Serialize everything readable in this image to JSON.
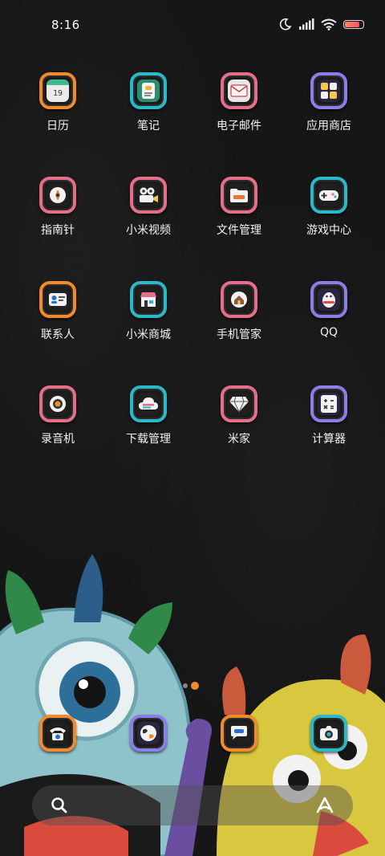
{
  "status_bar": {
    "time": "8:16",
    "icons": [
      "moon-icon",
      "signal-icon",
      "wifi-icon",
      "battery-icon"
    ],
    "battery_fill": 0.85
  },
  "apps": [
    {
      "label": "日历",
      "icon": "calendar-icon",
      "border": "#f08a2c",
      "glyph": "19"
    },
    {
      "label": "笔记",
      "icon": "notes-icon",
      "border": "#2bb8c9"
    },
    {
      "label": "电子邮件",
      "icon": "email-icon",
      "border": "#e56f88"
    },
    {
      "label": "应用商店",
      "icon": "app-store-icon",
      "border": "#8a7ee8"
    },
    {
      "label": "指南针",
      "icon": "compass-icon",
      "border": "#e56f88"
    },
    {
      "label": "小米视频",
      "icon": "video-camera-icon",
      "border": "#e56f88"
    },
    {
      "label": "文件管理",
      "icon": "folder-icon",
      "border": "#e56f88"
    },
    {
      "label": "游戏中心",
      "icon": "gamepad-icon",
      "border": "#2bb8c9"
    },
    {
      "label": "联系人",
      "icon": "contacts-icon",
      "border": "#f08a2c"
    },
    {
      "label": "小米商城",
      "icon": "store-icon",
      "border": "#2bb8c9"
    },
    {
      "label": "手机管家",
      "icon": "security-icon",
      "border": "#e56f88"
    },
    {
      "label": "QQ",
      "icon": "qq-icon",
      "border": "#8a7ee8"
    },
    {
      "label": "录音机",
      "icon": "recorder-icon",
      "border": "#e56f88"
    },
    {
      "label": "下载管理",
      "icon": "download-cloud-icon",
      "border": "#2bb8c9"
    },
    {
      "label": "米家",
      "icon": "mijia-icon",
      "border": "#e56f88"
    },
    {
      "label": "计算器",
      "icon": "calculator-icon",
      "border": "#8a7ee8"
    }
  ],
  "dock": [
    {
      "icon": "phone-icon",
      "border": "#f08a2c"
    },
    {
      "icon": "browser-icon",
      "border": "#8a7ee8"
    },
    {
      "icon": "messages-icon",
      "border": "#f08a2c"
    },
    {
      "icon": "camera-icon",
      "border": "#2bb8c9"
    }
  ],
  "page_indicator": {
    "pages": 2,
    "active": 1
  },
  "search_bar": {
    "search_icon": "search-icon",
    "assistant_icon": "assistant-icon"
  },
  "colors": {
    "orange": "#f08a2c",
    "teal": "#2bb8c9",
    "pink": "#e56f88",
    "purple": "#8a7ee8"
  }
}
